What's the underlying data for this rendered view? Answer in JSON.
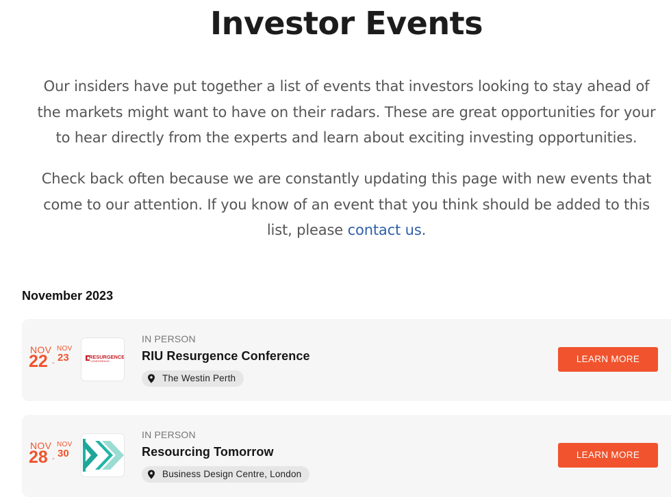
{
  "page": {
    "title": "Investor Events",
    "intro_paragraph_1": "Our insiders have put together a list of events that investors looking to stay ahead of the markets might want to have on their radars. These are great opportunities for your to hear directly from the experts and learn about exciting investing opportunities.",
    "intro_paragraph_2_prefix": "Check back often because we are constantly updating this page with new events that come to our attention. If you know of an event that you think should be added to this list, please ",
    "contact_link": "contact us",
    "intro_paragraph_2_suffix": "."
  },
  "colors": {
    "accent": "#f0532d",
    "link": "#2f5fa8",
    "card_background": "#f6f6f6",
    "chip_background": "#e6e6e6"
  },
  "events_section": {
    "month_heading": "November 2023",
    "events": [
      {
        "start_month": "NOV",
        "start_day": "22",
        "dash": "-",
        "end_month": "NOV",
        "end_day": "23",
        "logo_icon": "resurgence-conference-logo",
        "logo_text_top": "RESURGENCE",
        "logo_text_bottom": "CONFERENCE",
        "type": "IN PERSON",
        "name": "RIU Resurgence Conference",
        "location_icon": "map-pin-icon",
        "location": "The Westin Perth",
        "button_label": "LEARN MORE"
      },
      {
        "start_month": "NOV",
        "start_day": "28",
        "dash": "-",
        "end_month": "NOV",
        "end_day": "30",
        "logo_icon": "resourcing-tomorrow-chevron-logo",
        "type": "IN PERSON",
        "name": "Resourcing Tomorrow",
        "location_icon": "map-pin-icon",
        "location": "Business Design Centre, London",
        "button_label": "LEARN MORE"
      }
    ]
  }
}
